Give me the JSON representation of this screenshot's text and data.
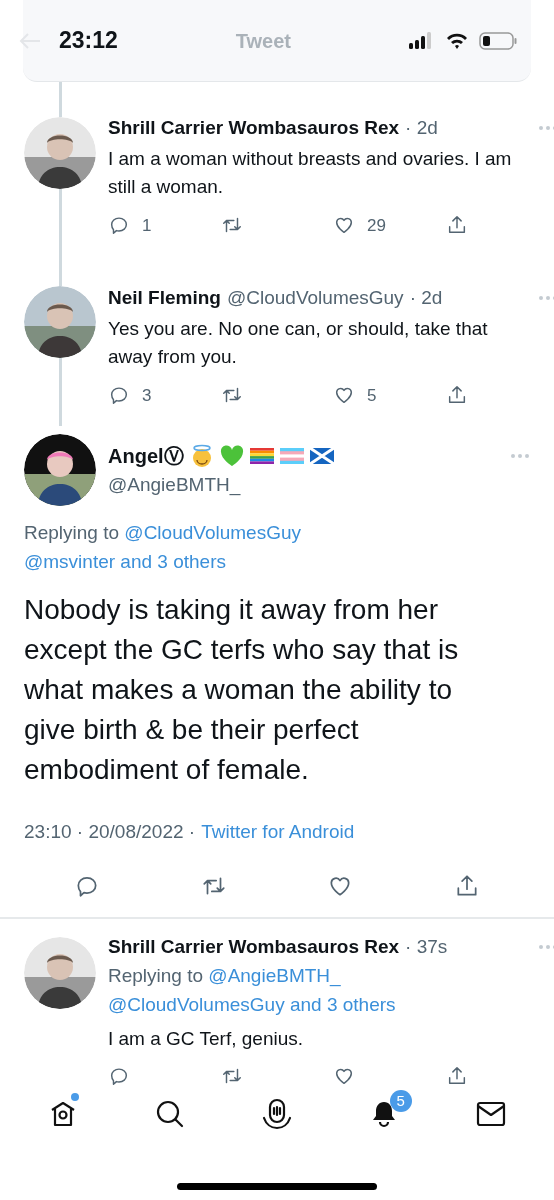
{
  "status_bar": {
    "time": "23:12"
  },
  "header": {
    "title": "Tweet"
  },
  "thread": [
    {
      "name": "Shrill Carrier Wombasauros Rex",
      "time": "· 2d",
      "text": "I am a woman without breasts and ovaries. I am still a woman.",
      "replies": "1",
      "likes": "29"
    },
    {
      "name": "Neil Fleming",
      "handle": "@CloudVolumesGuy",
      "time": "· 2d",
      "text": "Yes you are. No one can, or should, take that away from you.",
      "replies": "3",
      "likes": "5"
    }
  ],
  "main_tweet": {
    "name": "AngelⓋ",
    "handle": "@AngieBMTH_",
    "replying_prefix": "Replying to",
    "mentions": [
      "@CloudVolumesGuy",
      "@msvinter",
      "and 3 others"
    ],
    "text": "Nobody is taking it away from her except the GC terfs who say that is what makes a woman the ability to give birth & be their perfect embodiment of female.",
    "timestamp": "23:10 · 20/08/2022 ·",
    "source": "Twitter for Android"
  },
  "reply": {
    "name": "Shrill Carrier Wombasauros Rex",
    "time": "· 37s",
    "replying_prefix": "Replying to",
    "mentions": [
      "@AngieBMTH_",
      "@CloudVolumesGuy",
      "and 3 others"
    ],
    "text": "I am a GC Terf, genius."
  },
  "tab_bar": [
    {
      "kind": "home",
      "dot": true
    },
    {
      "kind": "search",
      "dot": false
    },
    {
      "kind": "spaces",
      "dot": false
    },
    {
      "kind": "notifications",
      "dot": false,
      "badge": "5"
    },
    {
      "kind": "messages",
      "dot": false
    }
  ]
}
